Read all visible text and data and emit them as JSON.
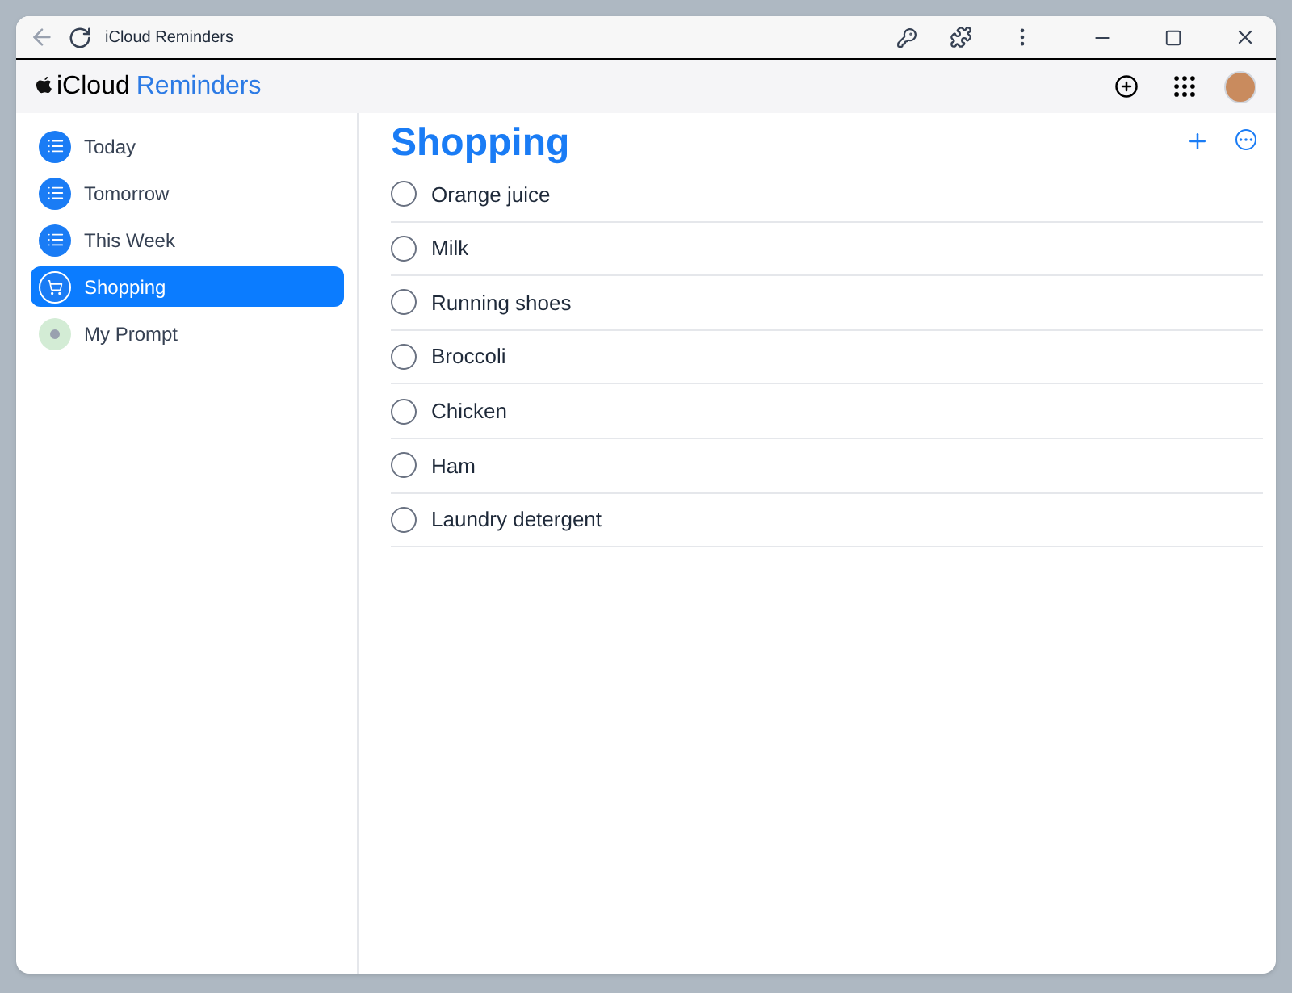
{
  "window": {
    "title": "iCloud Reminders"
  },
  "app_header": {
    "brand": "iCloud",
    "product": "Reminders"
  },
  "sidebar": {
    "items": [
      {
        "label": "Today",
        "kind": "list",
        "color": "#1a7cf5",
        "selected": false
      },
      {
        "label": "Tomorrow",
        "kind": "list",
        "color": "#1a7cf5",
        "selected": false
      },
      {
        "label": "This Week",
        "kind": "list",
        "color": "#1a7cf5",
        "selected": false
      },
      {
        "label": "Shopping",
        "kind": "cart",
        "color": "#1a7cf5",
        "selected": true
      },
      {
        "label": "My Prompt",
        "kind": "dot",
        "color": "#d3ecd5",
        "selected": false
      }
    ]
  },
  "list": {
    "title": "Shopping",
    "items": [
      {
        "text": "Orange juice",
        "checked": false
      },
      {
        "text": "Milk",
        "checked": false
      },
      {
        "text": "Running shoes",
        "checked": false
      },
      {
        "text": "Broccoli",
        "checked": false
      },
      {
        "text": "Chicken",
        "checked": false
      },
      {
        "text": "Ham",
        "checked": false
      },
      {
        "text": "Laundry detergent",
        "checked": false
      }
    ]
  }
}
